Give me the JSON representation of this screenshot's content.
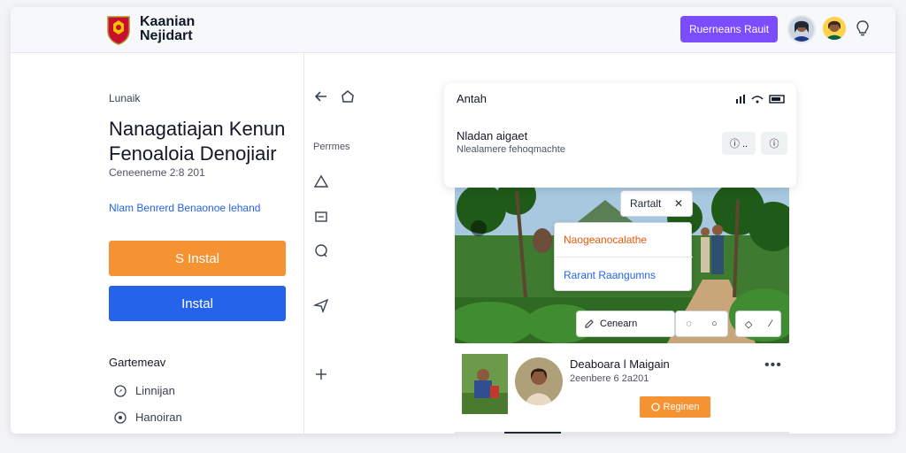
{
  "header": {
    "brand_line1": "Kaanian",
    "brand_line2": "Nejidart",
    "primary_button": "Ruerneans Rauit"
  },
  "left": {
    "breadcrumb": "Lunaik",
    "title_line1": "Nanagatiajan Kenun",
    "title_line2": "Fenoaloia Denojiair",
    "meta": "Ceneeneme 2:8 201",
    "link": "Nlam Benrerd Benaonoe lehand",
    "orange_button": "S  Instal",
    "blue_button": "Instal",
    "section_title": "Gartemeav",
    "options": [
      "Linnijan",
      "Hanoiran"
    ]
  },
  "rail": {
    "label": "Perrmes"
  },
  "card": {
    "title": "Antah",
    "subtitle": "Nladan aigaet",
    "description": "Nlealamere fehoqmachte",
    "btn1_label": "ⓘ ..",
    "btn2_label": "ⓘ"
  },
  "photo": {
    "tooltip_label": "Rartalt",
    "menu_item1": "Naogeanocalathe",
    "menu_item2": "Rarant Raangumns",
    "comment_label": "Cenearn"
  },
  "post": {
    "name": "Deaboara l Maigain",
    "date": "2eenbere 6 2a201",
    "more": "•••",
    "button_label": "Reginen"
  },
  "colors": {
    "accent_purple": "#7c4dff",
    "accent_orange": "#f59332",
    "accent_blue": "#2563eb"
  }
}
